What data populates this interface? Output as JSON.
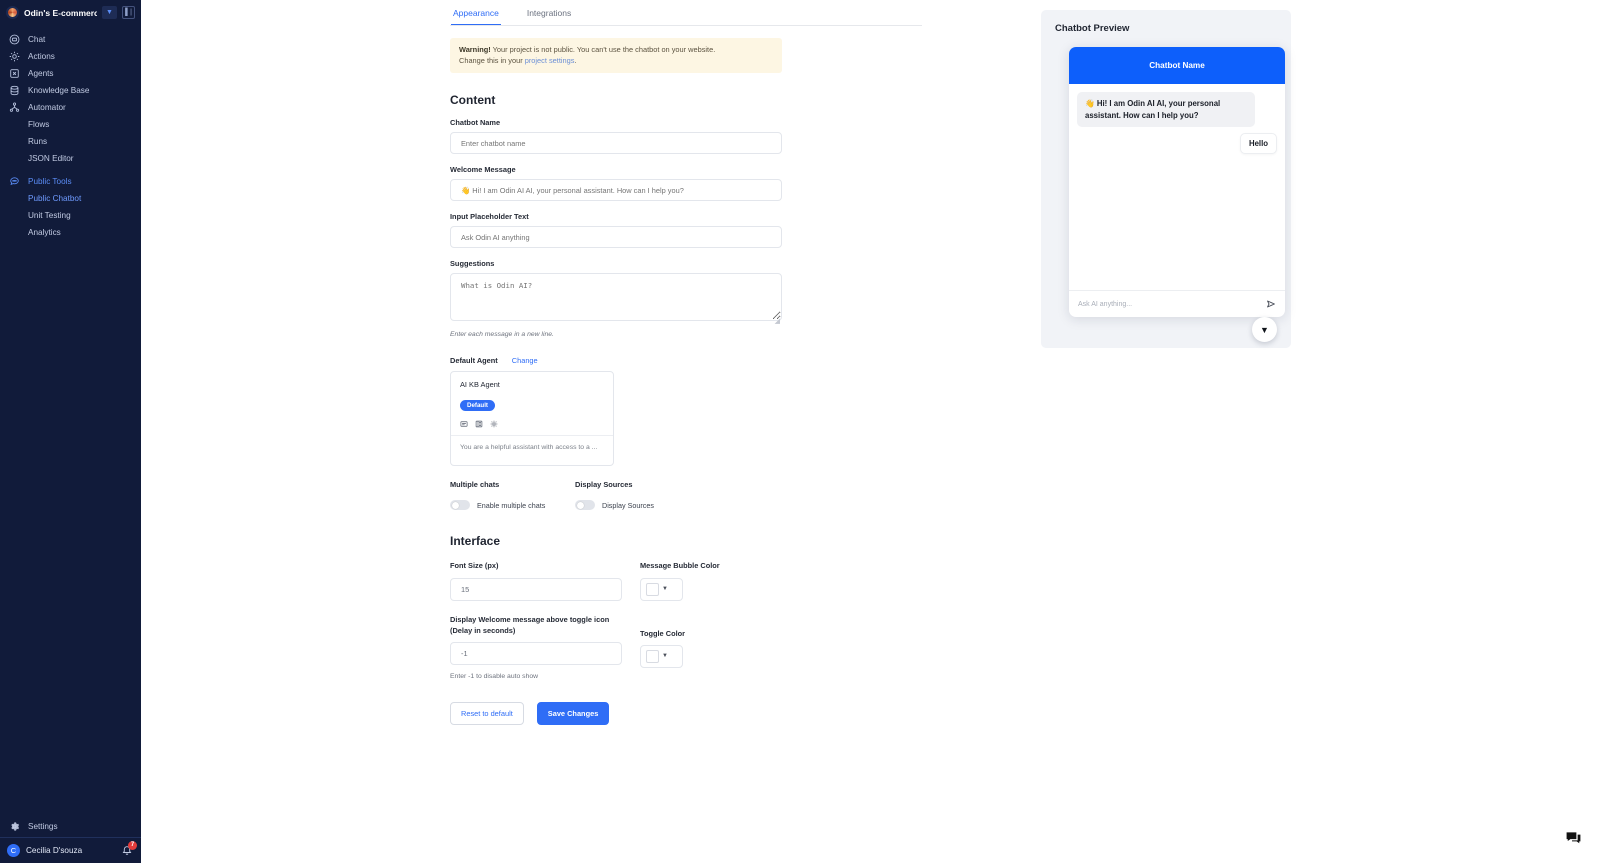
{
  "sidebar": {
    "project_name": "Odin's E-commerce ...",
    "logo_icon": "odin-logo-icon",
    "project_caret_icon": "chevron-down-icon",
    "collapse_icon": "panel-collapse-icon",
    "items": [
      {
        "label": "Chat",
        "icon": "chat-bubble-icon",
        "sub": false,
        "state": "normal"
      },
      {
        "label": "Actions",
        "icon": "gear-actions-icon",
        "sub": false,
        "state": "normal"
      },
      {
        "label": "Agents",
        "icon": "agents-icon",
        "sub": false,
        "state": "normal"
      },
      {
        "label": "Knowledge Base",
        "icon": "database-icon",
        "sub": false,
        "state": "normal"
      },
      {
        "label": "Automator",
        "icon": "automator-node-icon",
        "sub": false,
        "state": "normal"
      },
      {
        "label": "Flows",
        "icon": "",
        "sub": true,
        "state": "normal"
      },
      {
        "label": "Runs",
        "icon": "",
        "sub": true,
        "state": "normal"
      },
      {
        "label": "JSON Editor",
        "icon": "",
        "sub": true,
        "state": "normal"
      },
      {
        "label": "Public Tools",
        "icon": "public-tools-icon",
        "sub": false,
        "state": "active-group"
      },
      {
        "label": "Public Chatbot",
        "icon": "",
        "sub": true,
        "state": "active-sub"
      },
      {
        "label": "Unit Testing",
        "icon": "",
        "sub": true,
        "state": "normal"
      },
      {
        "label": "Analytics",
        "icon": "",
        "sub": true,
        "state": "normal"
      }
    ],
    "settings_label": "Settings",
    "settings_icon": "gear-icon",
    "user": {
      "name": "Cecilia D'souza",
      "avatar_initial": "C",
      "notification_icon": "bell-icon",
      "notification_count": "7"
    }
  },
  "tabs": [
    {
      "label": "Appearance",
      "active": true
    },
    {
      "label": "Integrations",
      "active": false
    }
  ],
  "warning": {
    "bold": "Warning!",
    "text": " Your project is not public. You can't use the chatbot on your website.",
    "text2": "Change this in your ",
    "link": "project settings",
    "period": "."
  },
  "content": {
    "heading": "Content",
    "chatbot_name": {
      "label": "Chatbot Name",
      "value": "",
      "placeholder": "Enter chatbot name"
    },
    "welcome_message": {
      "label": "Welcome Message",
      "value": "",
      "placeholder": "👋 Hi! I am Odin AI AI, your personal assistant. How can I help you?"
    },
    "input_placeholder_text": {
      "label": "Input Placeholder Text",
      "value": "",
      "placeholder": "Ask Odin AI anything"
    },
    "suggestions": {
      "label": "Suggestions",
      "value": "",
      "placeholder": "What is Odin AI?",
      "hint": "Enter each message in a new line."
    },
    "default_agent": {
      "label": "Default Agent",
      "change_label": "Change",
      "agent_name": "AI KB Agent",
      "badge": "Default",
      "icons": [
        "card-text-icon",
        "list-detail-icon",
        "gear-settings-icon"
      ],
      "description": "You are a helpful assistant with access to a ..."
    },
    "multiple_chats": {
      "label": "Multiple chats",
      "toggle_label": "Enable multiple chats",
      "enabled": false
    },
    "display_sources": {
      "label": "Display Sources",
      "toggle_label": "Display Sources",
      "enabled": false
    }
  },
  "interface": {
    "heading": "Interface",
    "font_size": {
      "label": "Font Size (px)",
      "value": "15"
    },
    "message_bubble_color": {
      "label": "Message Bubble Color",
      "value": "#ffffff",
      "caret_icon": "chevron-down-icon"
    },
    "welcome_delay": {
      "label": "Display Welcome message above toggle icon (Delay in seconds)",
      "value": "-1",
      "hint": "Enter -1 to disable auto show"
    },
    "toggle_color": {
      "label": "Toggle Color",
      "value": "#ffffff",
      "caret_icon": "chevron-down-icon"
    }
  },
  "actions": {
    "reset_label": "Reset to default",
    "save_label": "Save Changes"
  },
  "preview": {
    "title": "Chatbot Preview",
    "widget_header": "Chatbot Name",
    "header_color": "#0d5ffb",
    "bot_message": "👋 Hi! I am Odin AI AI, your personal assistant. How can I help you?",
    "user_message": "Hello",
    "input_placeholder": "Ask AI anything...",
    "send_icon": "send-icon",
    "toggle_icon": "chevron-down-icon"
  },
  "floating": {
    "chat_icon": "chat-widget-icon"
  }
}
